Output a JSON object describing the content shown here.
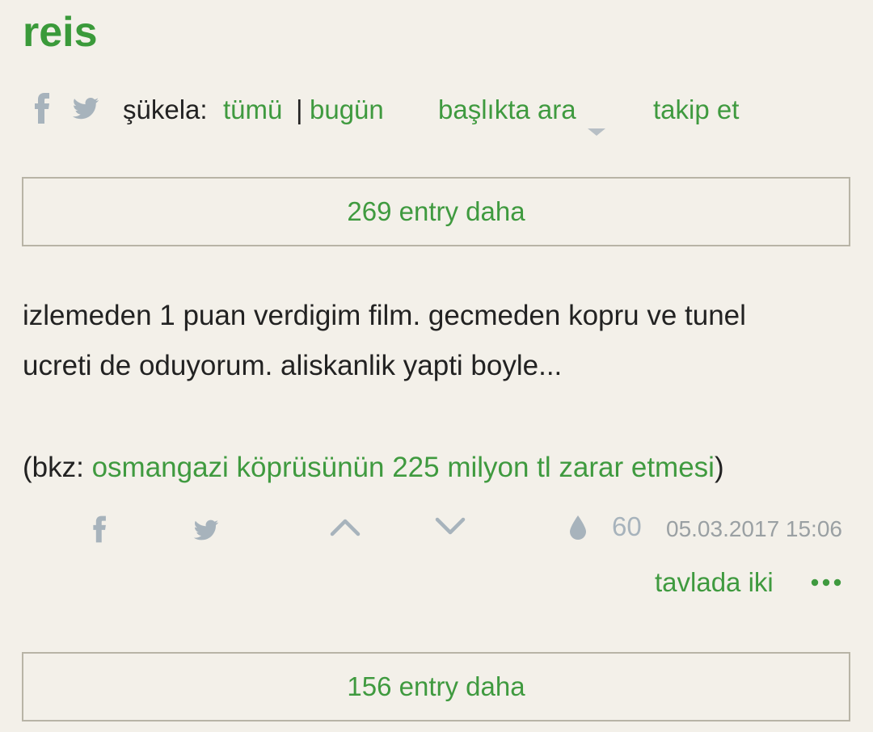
{
  "topic": {
    "title": "reis"
  },
  "topbar": {
    "sukela_label": "şükela:",
    "tumu": "tümü",
    "separator": "|",
    "bugun": "bugün",
    "baslikta_ara": "başlıkta ara",
    "takip_et": "takip et",
    "icons": [
      "facebook-icon",
      "twitter-icon",
      "caret-down-icon"
    ]
  },
  "more_before": {
    "label": "269 entry daha"
  },
  "entry": {
    "text_line1": "izlemeden 1 puan verdigim film. gecmeden kopru ve tunel",
    "text_line2": "ucreti de oduyorum. aliskanlik yapti boyle...",
    "bkz_prefix": "(bkz: ",
    "bkz_link": "osmangazi köprüsünün 225 milyon tl zarar etmesi",
    "bkz_suffix": ")",
    "favorite_count": "60",
    "date": "05.03.2017 15:06",
    "author": "tavlada iki",
    "icons": [
      "facebook-icon",
      "twitter-icon",
      "upvote-icon",
      "downvote-icon",
      "drop-icon",
      "more-dots-icon"
    ]
  },
  "more_after": {
    "label": "156 entry daha"
  },
  "colors": {
    "background": "#f3f0e9",
    "green": "#3f9a3f",
    "icon_gray": "#a7b3bc",
    "border": "#b8b4a6"
  }
}
